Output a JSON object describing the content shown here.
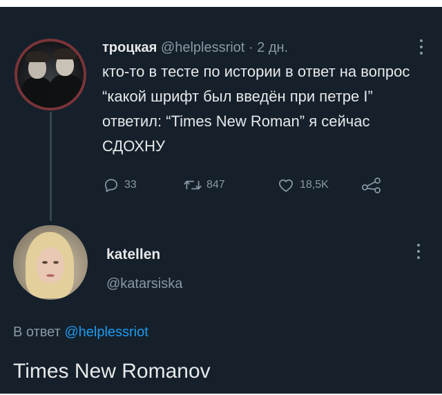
{
  "tweet1": {
    "author_name": "троцкая",
    "handle": "@helplessriot",
    "separator": "·",
    "time": "2 дн.",
    "text": "кто-то в тесте по истории в ответ на вопрос “какой шрифт был введён при петре I” ответил: “Times New Roman” я сейчас СДОХНУ",
    "actions": {
      "replies": "33",
      "retweets": "847",
      "likes": "18,5K"
    }
  },
  "tweet2": {
    "author_name": "katellen",
    "handle": "@katarsiska",
    "reply_prefix": "В ответ",
    "reply_handle": "@helplessriot",
    "text": "Times New Romanov"
  },
  "colors": {
    "background": "#15202b",
    "text_primary": "#e7e9ea",
    "text_secondary": "#8b98a5",
    "link": "#1d9bf0",
    "thread_line": "#38444d"
  },
  "icons": [
    "reply-icon",
    "retweet-icon",
    "like-icon",
    "share-icon",
    "more-icon"
  ]
}
